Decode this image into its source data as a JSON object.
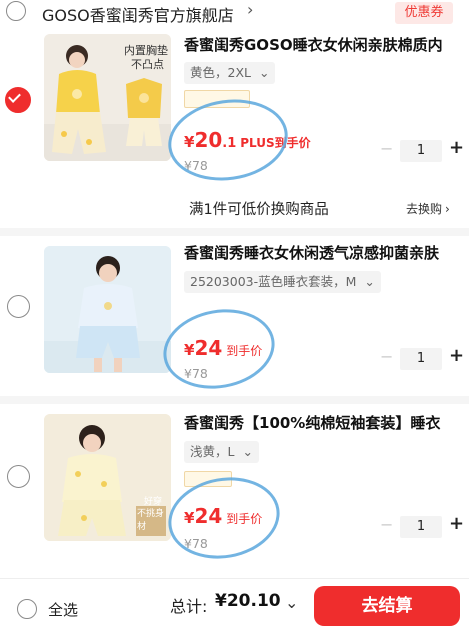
{
  "store": {
    "name": "GOSO香蜜闺秀官方旗舰店",
    "chevron": "›",
    "coupon_label": "优惠券"
  },
  "items": [
    {
      "checked": true,
      "title": "香蜜闺秀GOSO睡衣女休闲亲肤棉质内",
      "spec": "黄色，2XL",
      "spec_chevron": "⌄",
      "thumb_text_1": "内置胸垫",
      "thumb_text_2": "不凸点",
      "price_yen": "¥",
      "price_int": "20",
      "price_dec": ".1",
      "price_tag": "PLUS到手价",
      "orig_price": "¥78",
      "qty": "1"
    },
    {
      "checked": false,
      "title": "香蜜闺秀睡衣女休闲透气凉感抑菌亲肤",
      "spec": "25203003-蓝色睡衣套装，M",
      "spec_chevron": "⌄",
      "price_yen": "¥",
      "price_int": "24",
      "price_tag": "到手价",
      "orig_price": "¥78",
      "qty": "1"
    },
    {
      "checked": false,
      "title": "香蜜闺秀【100%纯棉短袖套装】睡衣",
      "spec": "浅黄，L",
      "spec_chevron": "⌄",
      "thumb_text_1": "好穿",
      "thumb_text_2": "不挑身材",
      "price_yen": "¥",
      "price_int": "24",
      "price_tag": "到手价",
      "orig_price": "¥78",
      "qty": "1"
    }
  ],
  "promo": {
    "text": "满1件可低价换购商品",
    "link": "去换购",
    "link_chevron": "›"
  },
  "footer": {
    "select_all": "全选",
    "total_label": "总计:",
    "total_value": "¥20.10",
    "total_chevron": "⌄",
    "checkout": "去结算"
  },
  "colors": {
    "accent": "#ef2d2d",
    "annotation": "#5ba7dd",
    "coupon_bg": "#fde8e6"
  }
}
